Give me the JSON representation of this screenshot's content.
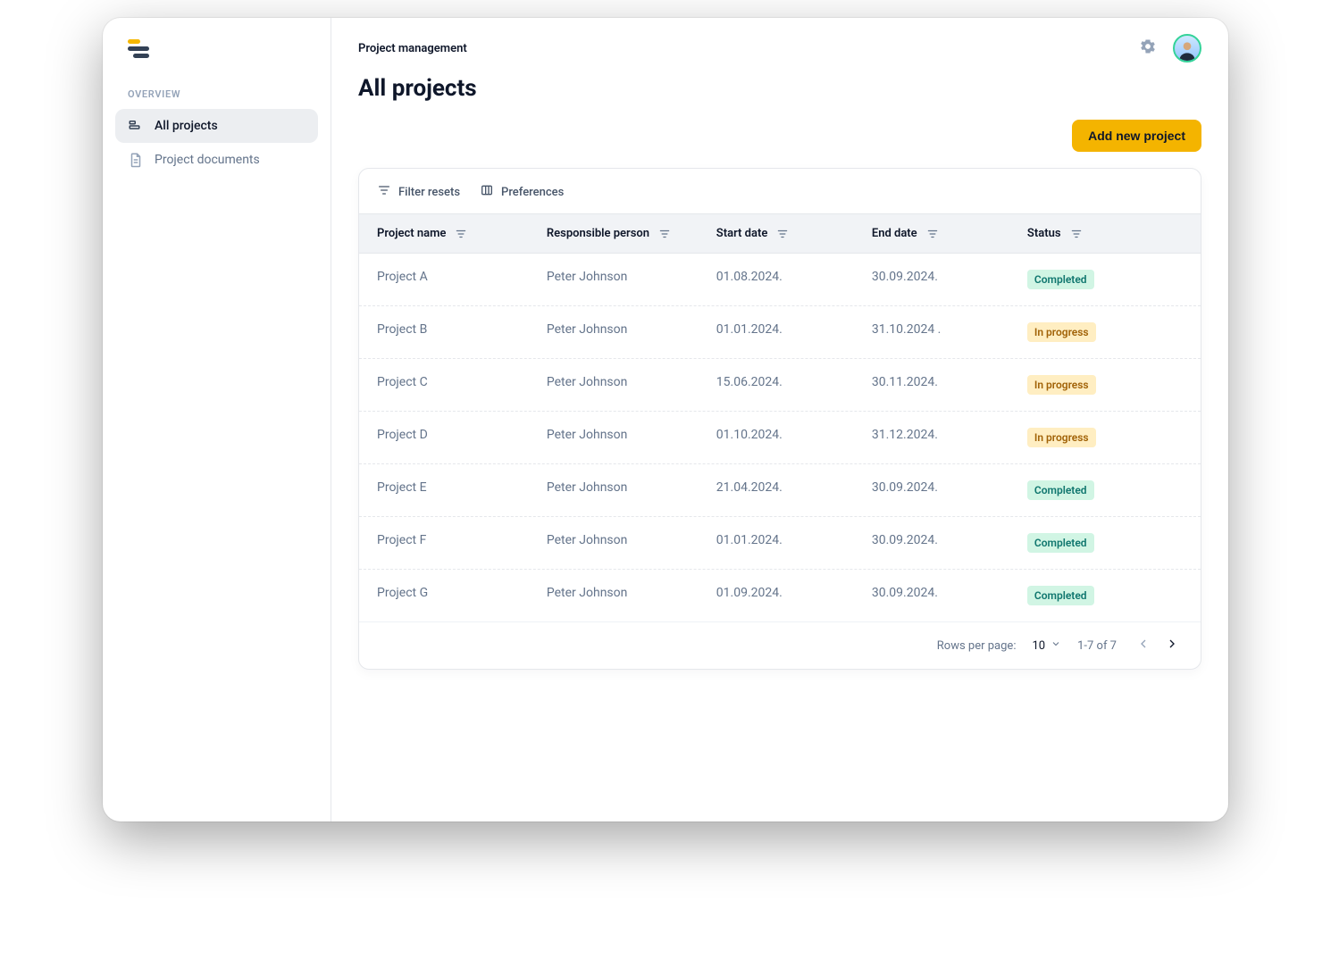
{
  "sidebar": {
    "section_label": "OVERVIEW",
    "items": [
      {
        "label": "All projects",
        "active": true
      },
      {
        "label": "Project documents",
        "active": false
      }
    ]
  },
  "header": {
    "breadcrumb": "Project management",
    "page_title": "All projects"
  },
  "actions": {
    "add_project_label": "Add new project"
  },
  "table": {
    "toolbar": {
      "filter_resets": "Filter resets",
      "preferences": "Preferences"
    },
    "columns": [
      "Project name",
      "Responsible person",
      "Start date",
      "End date",
      "Status"
    ],
    "status_labels": {
      "completed": "Completed",
      "in_progress": "In progress"
    },
    "rows": [
      {
        "name": "Project A",
        "person": "Peter Johnson",
        "start": "01.08.2024.",
        "end": "30.09.2024.",
        "status": "completed"
      },
      {
        "name": "Project B",
        "person": "Peter Johnson",
        "start": "01.01.2024.",
        "end": "31.10.2024 .",
        "status": "in_progress"
      },
      {
        "name": "Project C",
        "person": "Peter Johnson",
        "start": "15.06.2024.",
        "end": "30.11.2024.",
        "status": "in_progress"
      },
      {
        "name": "Project D",
        "person": "Peter Johnson",
        "start": "01.10.2024.",
        "end": "31.12.2024.",
        "status": "in_progress"
      },
      {
        "name": "Project E",
        "person": "Peter Johnson",
        "start": "21.04.2024.",
        "end": "30.09.2024.",
        "status": "completed"
      },
      {
        "name": "Project F",
        "person": "Peter Johnson",
        "start": "01.01.2024.",
        "end": "30.09.2024.",
        "status": "completed"
      },
      {
        "name": "Project G",
        "person": "Peter Johnson",
        "start": "01.09.2024.",
        "end": "30.09.2024.",
        "status": "completed"
      }
    ]
  },
  "pager": {
    "rows_label": "Rows per page:",
    "rows_value": "10",
    "range_text": "1-7 of 7"
  }
}
